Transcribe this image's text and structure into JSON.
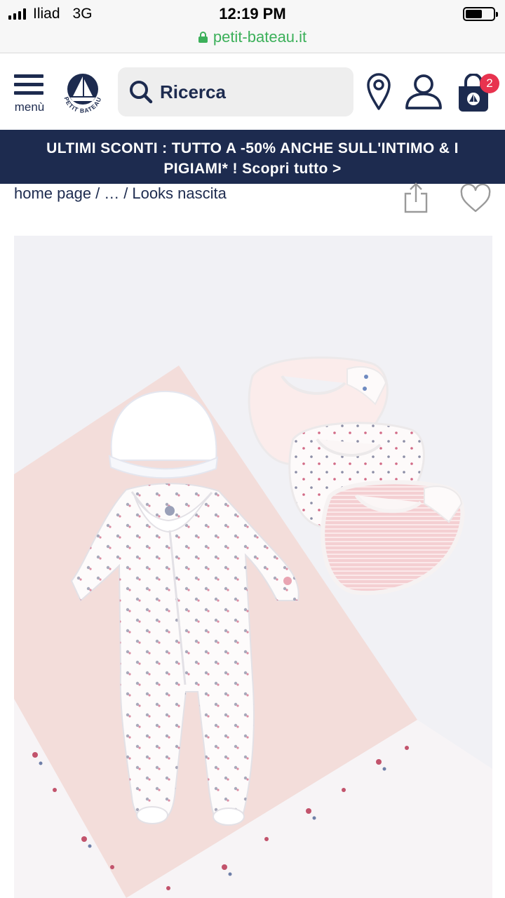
{
  "status_bar": {
    "carrier": "Iliad",
    "network": "3G",
    "time": "12:19 PM"
  },
  "browser": {
    "url": "petit-bateau.it"
  },
  "header": {
    "menu_label": "menù",
    "search_placeholder": "Ricerca",
    "cart_count": "2",
    "logo_text": "PETIT BATEAU",
    "icons": [
      "menu-icon",
      "search-icon",
      "store-locator-icon",
      "account-icon",
      "cart-icon"
    ]
  },
  "promo": {
    "line1": "ULTIMI SCONTI : TUTTO A -50% ANCHE SULL'INTIMO & I",
    "line2": "PIGIAMI* ! Scopri tutto >"
  },
  "breadcrumb": {
    "home": "home page",
    "sep": "/",
    "ellipsis": "…",
    "current": "Looks nascita"
  },
  "colors": {
    "navy": "#1d2b4f",
    "badge": "#e8334f",
    "secure": "#3cb05a",
    "pink_bg": "#f3ddda"
  }
}
